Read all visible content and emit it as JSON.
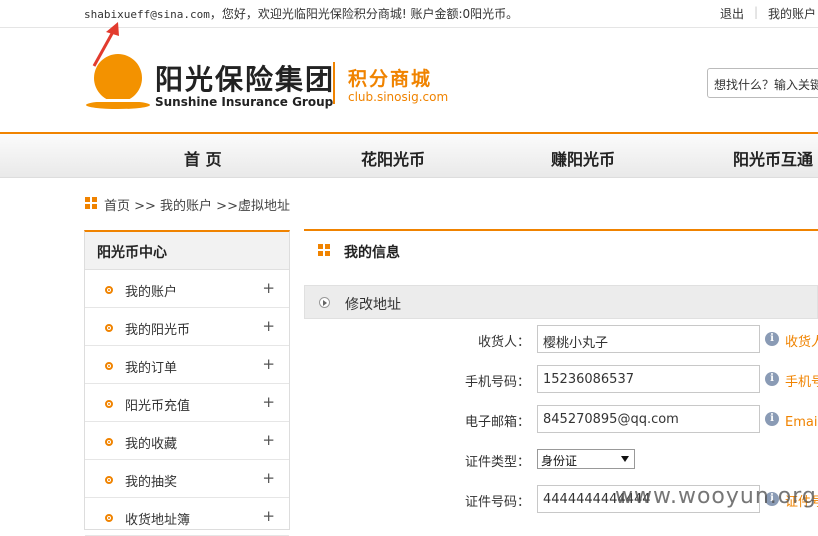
{
  "topbar": {
    "email": "shabixueff@sina.com",
    "welcome_text": "，您好，欢迎光临阳光保险积分商城! 账户金额:0阳光币。",
    "logout": "退出",
    "separator": "|",
    "my_account": "我的账户"
  },
  "header": {
    "brand_cn": "阳光保险集团",
    "brand_en": "Sunshine Insurance Group",
    "mall_name": "积分商城",
    "mall_url": "club.sinosig.com",
    "search_placeholder": "想找什么？输入关键"
  },
  "nav": {
    "items": [
      "首 页",
      "花阳光币",
      "赚阳光币",
      "阳光币互通"
    ]
  },
  "breadcrumb": "首页 >> 我的账户 >>虚拟地址",
  "sidebar": {
    "title": "阳光币中心",
    "items": [
      "我的账户",
      "我的阳光币",
      "我的订单",
      "阳光币充值",
      "我的收藏",
      "我的抽奖",
      "收货地址簿"
    ],
    "expand_symbol": "+"
  },
  "main": {
    "title": "我的信息",
    "section_title": "修改地址",
    "fields": {
      "receiver_label": "收货人：",
      "receiver_value": "樱桃小丸子",
      "receiver_hint": "收货人",
      "phone_label": "手机号码：",
      "phone_value": "15236086537",
      "phone_hint": "手机号",
      "email_label": "电子邮箱：",
      "email_value": "845270895@qq.com",
      "email_hint": "Email为",
      "idtype_label": "证件类型：",
      "idtype_value": "身份证",
      "idno_label": "证件号码：",
      "idno_value": "4444444444444",
      "idno_hint": "证件号"
    },
    "info_icon": "i"
  },
  "watermark": "www.wooyun.org",
  "colors": {
    "accent": "#f08300"
  }
}
